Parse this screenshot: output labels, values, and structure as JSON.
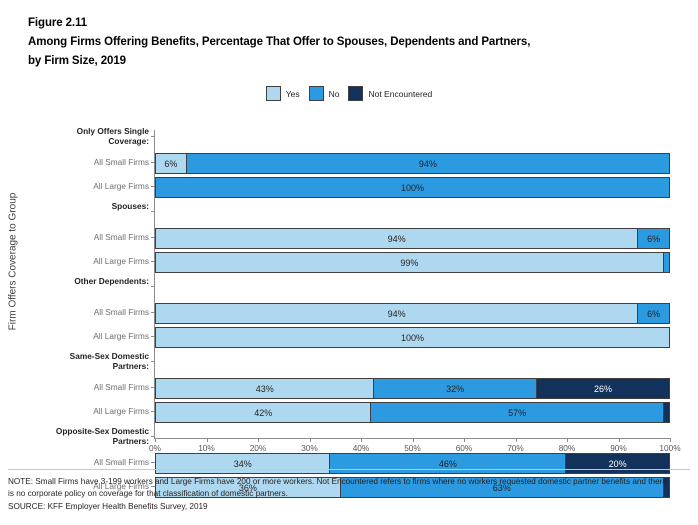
{
  "title": {
    "figure_number": "Figure 2.11",
    "line1": "Among Firms Offering Benefits, Percentage That Offer to Spouses, Dependents and Partners,",
    "line2": "by Firm Size, 2019"
  },
  "legend": [
    {
      "label": "Yes",
      "color": "#aed8ef",
      "key": "yes"
    },
    {
      "label": "No",
      "color": "#2b9ae1",
      "key": "no"
    },
    {
      "label": "Not Encountered",
      "color": "#12315b",
      "key": "ne"
    }
  ],
  "footnotes": {
    "note": "NOTE: Small Firms have 3-199 workers and Large Firms have 200 or more workers. Not Encountered refers to firms where no workers requested domestic partner benefits and there is no corporate policy on coverage for that classification of domestic partners.",
    "source": "SOURCE: KFF Employer Health Benefits Survey, 2019"
  },
  "chart_data": {
    "type": "bar",
    "orientation": "horizontal",
    "stacked": true,
    "title": "Among Firms Offering Benefits, Percentage That Offer to Spouses, Dependents and Partners, by Firm Size, 2019",
    "xlabel": "",
    "ylabel": "Firm Offers Coverage to Group",
    "xlim": [
      0,
      100
    ],
    "grid": false,
    "legend_position": "top-center",
    "x_ticks": [
      "0%",
      "10%",
      "20%",
      "30%",
      "40%",
      "50%",
      "60%",
      "70%",
      "80%",
      "90%",
      "100%"
    ],
    "x_tick_values": [
      0,
      10,
      20,
      30,
      40,
      50,
      60,
      70,
      80,
      90,
      100
    ],
    "series": [
      {
        "name": "Yes",
        "color": "#aed8ef"
      },
      {
        "name": "No",
        "color": "#2b9ae1"
      },
      {
        "name": "Not Encountered",
        "color": "#12315b"
      }
    ],
    "groups": [
      {
        "heading": "Only Offers Single\nCoverage:",
        "rows": [
          {
            "label": "All Small Firms",
            "segments": [
              {
                "key": "yes",
                "value": 6,
                "label": "6%"
              },
              {
                "key": "no",
                "value": 94,
                "label": "94%"
              }
            ]
          },
          {
            "label": "All Large Firms",
            "segments": [
              {
                "key": "no",
                "value": 100,
                "label": "100%"
              }
            ]
          }
        ]
      },
      {
        "heading": "Spouses:",
        "rows": [
          {
            "label": "All Small Firms",
            "segments": [
              {
                "key": "yes",
                "value": 94,
                "label": "94%"
              },
              {
                "key": "no",
                "value": 6,
                "label": "6%"
              }
            ]
          },
          {
            "label": "All Large Firms",
            "segments": [
              {
                "key": "yes",
                "value": 99,
                "label": "99%"
              },
              {
                "key": "no",
                "value": 1,
                "label": ""
              }
            ]
          }
        ]
      },
      {
        "heading": "Other Dependents:",
        "rows": [
          {
            "label": "All Small Firms",
            "segments": [
              {
                "key": "yes",
                "value": 94,
                "label": "94%"
              },
              {
                "key": "no",
                "value": 6,
                "label": "6%"
              }
            ]
          },
          {
            "label": "All Large Firms",
            "segments": [
              {
                "key": "yes",
                "value": 100,
                "label": "100%"
              }
            ]
          }
        ]
      },
      {
        "heading": "Same-Sex Domestic\nPartners:",
        "rows": [
          {
            "label": "All Small Firms",
            "segments": [
              {
                "key": "yes",
                "value": 43,
                "label": "43%"
              },
              {
                "key": "no",
                "value": 32,
                "label": "32%"
              },
              {
                "key": "ne",
                "value": 26,
                "label": "26%"
              }
            ]
          },
          {
            "label": "All Large Firms",
            "segments": [
              {
                "key": "yes",
                "value": 42,
                "label": "42%"
              },
              {
                "key": "no",
                "value": 57,
                "label": "57%"
              },
              {
                "key": "ne",
                "value": 1,
                "label": ""
              }
            ]
          }
        ]
      },
      {
        "heading": "Opposite-Sex Domestic\nPartners:",
        "rows": [
          {
            "label": "All Small Firms",
            "segments": [
              {
                "key": "yes",
                "value": 34,
                "label": "34%"
              },
              {
                "key": "no",
                "value": 46,
                "label": "46%"
              },
              {
                "key": "ne",
                "value": 20,
                "label": "20%"
              }
            ]
          },
          {
            "label": "All Large Firms",
            "segments": [
              {
                "key": "yes",
                "value": 36,
                "label": "36%"
              },
              {
                "key": "no",
                "value": 63,
                "label": "63%"
              },
              {
                "key": "ne",
                "value": 1,
                "label": ""
              }
            ]
          }
        ]
      }
    ]
  }
}
